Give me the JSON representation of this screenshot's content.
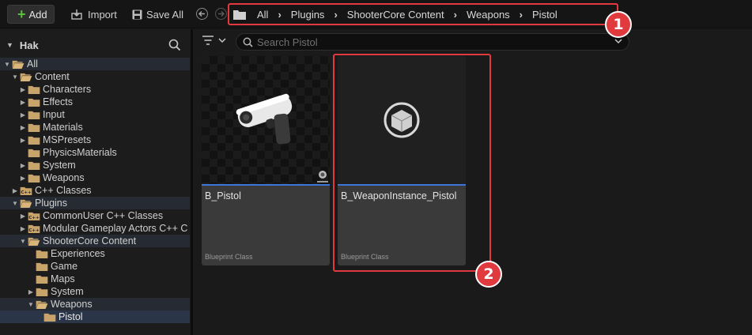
{
  "toolbar": {
    "add_label": "Add",
    "import_label": "Import",
    "save_all_label": "Save All"
  },
  "breadcrumb": [
    "All",
    "Plugins",
    "ShooterCore Content",
    "Weapons",
    "Pistol"
  ],
  "annotations": [
    "1",
    "2"
  ],
  "left_panel": {
    "title": "Hak",
    "tree": [
      {
        "label": "All",
        "depth": 0,
        "arrow": "open",
        "icon": "folder-open",
        "style": "hover"
      },
      {
        "label": "Content",
        "depth": 1,
        "arrow": "open",
        "icon": "folder-open",
        "style": ""
      },
      {
        "label": "Characters",
        "depth": 2,
        "arrow": "closed",
        "icon": "folder",
        "style": ""
      },
      {
        "label": "Effects",
        "depth": 2,
        "arrow": "closed",
        "icon": "folder",
        "style": ""
      },
      {
        "label": "Input",
        "depth": 2,
        "arrow": "closed",
        "icon": "folder",
        "style": ""
      },
      {
        "label": "Materials",
        "depth": 2,
        "arrow": "closed",
        "icon": "folder",
        "style": ""
      },
      {
        "label": "MSPresets",
        "depth": 2,
        "arrow": "closed",
        "icon": "folder",
        "style": ""
      },
      {
        "label": "PhysicsMaterials",
        "depth": 2,
        "arrow": "none",
        "icon": "folder",
        "style": ""
      },
      {
        "label": "System",
        "depth": 2,
        "arrow": "closed",
        "icon": "folder",
        "style": ""
      },
      {
        "label": "Weapons",
        "depth": 2,
        "arrow": "closed",
        "icon": "folder",
        "style": ""
      },
      {
        "label": "C++ Classes",
        "depth": 1,
        "arrow": "closed",
        "icon": "cpp",
        "style": ""
      },
      {
        "label": "Plugins",
        "depth": 1,
        "arrow": "open",
        "icon": "folder-open",
        "style": "hover"
      },
      {
        "label": "CommonUser C++ Classes",
        "depth": 2,
        "arrow": "closed",
        "icon": "cpp",
        "style": ""
      },
      {
        "label": "Modular Gameplay Actors C++ C",
        "depth": 2,
        "arrow": "closed",
        "icon": "cpp",
        "style": ""
      },
      {
        "label": "ShooterCore Content",
        "depth": 2,
        "arrow": "open",
        "icon": "folder-open",
        "style": "hover"
      },
      {
        "label": "Experiences",
        "depth": 3,
        "arrow": "none",
        "icon": "folder",
        "style": ""
      },
      {
        "label": "Game",
        "depth": 3,
        "arrow": "none",
        "icon": "folder",
        "style": ""
      },
      {
        "label": "Maps",
        "depth": 3,
        "arrow": "none",
        "icon": "folder",
        "style": ""
      },
      {
        "label": "System",
        "depth": 3,
        "arrow": "closed",
        "icon": "folder",
        "style": ""
      },
      {
        "label": "Weapons",
        "depth": 3,
        "arrow": "open",
        "icon": "folder-open",
        "style": "hover"
      },
      {
        "label": "Pistol",
        "depth": 4,
        "arrow": "none",
        "icon": "folder",
        "style": "selected"
      }
    ]
  },
  "content": {
    "search_placeholder": "Search Pistol",
    "assets": [
      {
        "name": "B_Pistol",
        "type": "Blueprint Class",
        "thumbnail": "pistol-thumbnail"
      },
      {
        "name": "B_WeaponInstance_Pistol",
        "type": "Blueprint Class",
        "thumbnail": "cube-icon"
      }
    ]
  },
  "colors": {
    "annotation_red": "#e0393e",
    "selection_blue": "#3d74d8",
    "folder": "#c9a46a",
    "add_green": "#5cbf3c"
  }
}
